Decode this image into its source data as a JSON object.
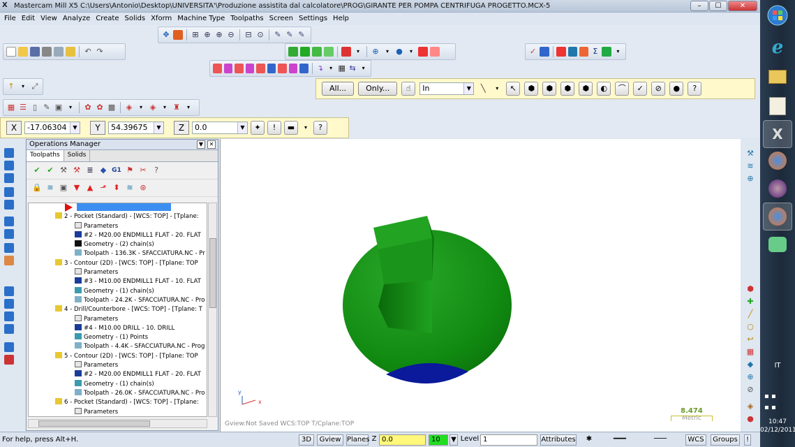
{
  "window": {
    "app_icon": "X",
    "title": "Mastercam Mill X5  C:\\Users\\Antonio\\Desktop\\UNIVERSITA'\\Produzione assistita dal calcolatore\\PROG\\GIRANTE PER POMPA CENTRIFUGA PROGETTO.MCX-5",
    "buttons": [
      "–",
      "☐",
      "✕"
    ]
  },
  "menu": [
    "File",
    "Edit",
    "View",
    "Analyze",
    "Create",
    "Solids",
    "Xform",
    "Machine Type",
    "Toolpaths",
    "Screen",
    "Settings",
    "Help"
  ],
  "selection_bar": {
    "all_label": "All...",
    "only_label": "Only...",
    "mode_value": "In"
  },
  "coords": {
    "x_label": "X",
    "x_value": "-17.06304",
    "y_label": "Y",
    "y_value": "54.39675",
    "z_label": "Z",
    "z_value": "0.0"
  },
  "ops_manager": {
    "title": "Operations Manager",
    "tabs": [
      "Toolpaths",
      "Solids"
    ],
    "tree": [
      {
        "level": 1,
        "icon": "folder",
        "text": "2 - Pocket (Standard) - [WCS: TOP] - [Tplane:"
      },
      {
        "level": 2,
        "icon": "params",
        "text": "Parameters"
      },
      {
        "level": 2,
        "icon": "tool",
        "text": "#2 - M20.00 ENDMILL1 FLAT -     20. FLAT"
      },
      {
        "level": 2,
        "icon": "geom-dark",
        "text": "Geometry - (2) chain(s)"
      },
      {
        "level": 2,
        "icon": "path",
        "text": "Toolpath - 136.3K - SFACCIATURA.NC - Pr"
      },
      {
        "level": 1,
        "icon": "folder",
        "text": "3 - Contour (2D) - [WCS: TOP] - [Tplane: TOP"
      },
      {
        "level": 2,
        "icon": "params",
        "text": "Parameters"
      },
      {
        "level": 2,
        "icon": "tool",
        "text": "#3 - M10.00 ENDMILL1 FLAT -     10. FLAT"
      },
      {
        "level": 2,
        "icon": "geom",
        "text": "Geometry - (1) chain(s)"
      },
      {
        "level": 2,
        "icon": "path",
        "text": "Toolpath - 24.2K - SFACCIATURA.NC - Pro"
      },
      {
        "level": 1,
        "icon": "folder",
        "text": "4 - Drill/Counterbore - [WCS: TOP] - [Tplane: T"
      },
      {
        "level": 2,
        "icon": "params",
        "text": "Parameters"
      },
      {
        "level": 2,
        "icon": "tool",
        "text": "#4 - M10.00 DRILL -     10. DRILL"
      },
      {
        "level": 2,
        "icon": "geom",
        "text": "Geometry - (1) Points"
      },
      {
        "level": 2,
        "icon": "path",
        "text": "Toolpath - 4.4K - SFACCIATURA.NC - Prog"
      },
      {
        "level": 1,
        "icon": "folder",
        "text": "5 - Contour (2D) - [WCS: TOP] - [Tplane: TOP"
      },
      {
        "level": 2,
        "icon": "params",
        "text": "Parameters"
      },
      {
        "level": 2,
        "icon": "tool",
        "text": "#2 - M20.00 ENDMILL1 FLAT -     20. FLAT"
      },
      {
        "level": 2,
        "icon": "geom",
        "text": "Geometry - (1) chain(s)"
      },
      {
        "level": 2,
        "icon": "path",
        "text": "Toolpath - 26.0K - SFACCIATURA.NC - Pro"
      },
      {
        "level": 1,
        "icon": "folder",
        "text": "6 - Pocket (Standard) - [WCS: TOP] - [Tplane:"
      },
      {
        "level": 2,
        "icon": "params",
        "text": "Parameters"
      }
    ]
  },
  "viewport": {
    "status": "Gview:Not Saved    WCS:TOP    T/Cplane:TOP",
    "scale_value": "8.474",
    "scale_unit": "Metric",
    "axis_y": "y",
    "axis_x": "x",
    "colors": {
      "solid": "#1c8c1c",
      "bottom": "#0a1a9a"
    }
  },
  "status_bar": {
    "help": "For help, press Alt+H.",
    "btn_3d": "3D",
    "btn_gview": "Gview",
    "btn_planes": "Planes",
    "z_label": "Z",
    "z_value": "0.0",
    "color_value": "10",
    "level_label": "Level",
    "level_value": "1",
    "attributes": "Attributes",
    "wcs": "WCS",
    "groups": "Groups"
  },
  "taskbar": {
    "lang": "IT",
    "time": "10:47",
    "date": "02/12/2011"
  }
}
